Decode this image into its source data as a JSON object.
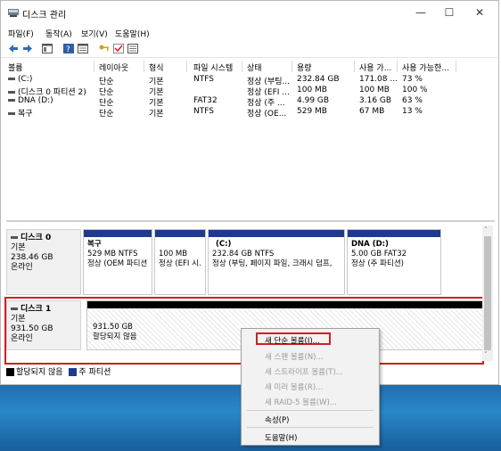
{
  "window": {
    "title": "디스크 관리",
    "minimize": "—",
    "maximize": "☐",
    "close": "✕"
  },
  "menu": [
    "파일(F)",
    "동작(A)",
    "보기(V)",
    "도움말(H)"
  ],
  "toolbar_icons": [
    "back-arrow-icon",
    "forward-arrow-icon",
    "console-icon",
    "help-icon",
    "properties-icon",
    "key-icon",
    "check-icon",
    "list-icon"
  ],
  "volume_table": {
    "headers": [
      "볼륨",
      "레이아웃",
      "형식",
      "파일 시스템",
      "상태",
      "용량",
      "사용 가...",
      "사용 가능한..."
    ],
    "rows": [
      [
        "(C:)",
        "단순",
        "기본",
        "NTFS",
        "정상 (부팅...",
        "232.84 GB",
        "171.08 ...",
        "73 %"
      ],
      [
        "(디스크 0 파티션 2)",
        "단순",
        "기본",
        "",
        "정상 (EFI ...",
        "100 MB",
        "100 MB",
        "100 %"
      ],
      [
        "DNA (D:)",
        "단순",
        "기본",
        "FAT32",
        "정상 (주 ...",
        "4.99 GB",
        "3.16 GB",
        "63 %"
      ],
      [
        "복구",
        "단순",
        "기본",
        "NTFS",
        "정상 (OE...",
        "529 MB",
        "67 MB",
        "13 %"
      ]
    ]
  },
  "disks": [
    {
      "title": "디스크 0",
      "type": "기본",
      "size": "238.46 GB",
      "status": "온라인",
      "partitions": [
        {
          "line1": "복구",
          "line2": "529 MB NTFS",
          "line3": "정상 (OEM 파티션"
        },
        {
          "line1": "",
          "line2": "100 MB",
          "line3": "정상 (EFI 시."
        },
        {
          "line1": "(C:)",
          "line2": "232.84 GB NTFS",
          "line3": "정상 (부팅, 페이지 파일, 크래시 덤프,"
        },
        {
          "line1": "DNA  (D:)",
          "line2": "5.00 GB FAT32",
          "line3": "정상 (주 파티션)"
        }
      ]
    },
    {
      "title": "디스크 1",
      "type": "기본",
      "size": "931.50 GB",
      "status": "온라인",
      "unallocated": {
        "size": "931.50 GB",
        "label": "할당되지 않음"
      }
    }
  ],
  "legend": [
    {
      "label": "할당되지 않음",
      "color": "#000000"
    },
    {
      "label": "주 파티션",
      "color": "#1e3a8a"
    }
  ],
  "context_menu": {
    "items": [
      {
        "label": "새 단순 볼륨(I)...",
        "enabled": true
      },
      {
        "label": "새 스팬 볼륨(N)...",
        "enabled": false
      },
      {
        "label": "새 스트라이프 볼륨(T)...",
        "enabled": false
      },
      {
        "label": "새 미러 볼륨(R)...",
        "enabled": false
      },
      {
        "label": "새 RAID-5 볼륨(W)...",
        "enabled": false
      },
      {
        "label": "속성(P)",
        "enabled": true
      },
      {
        "label": "도움말(H)",
        "enabled": true
      }
    ]
  },
  "colors": {
    "primary_partition": "#1e3a8a",
    "unallocated": "#000000",
    "highlight": "#cc2222"
  }
}
